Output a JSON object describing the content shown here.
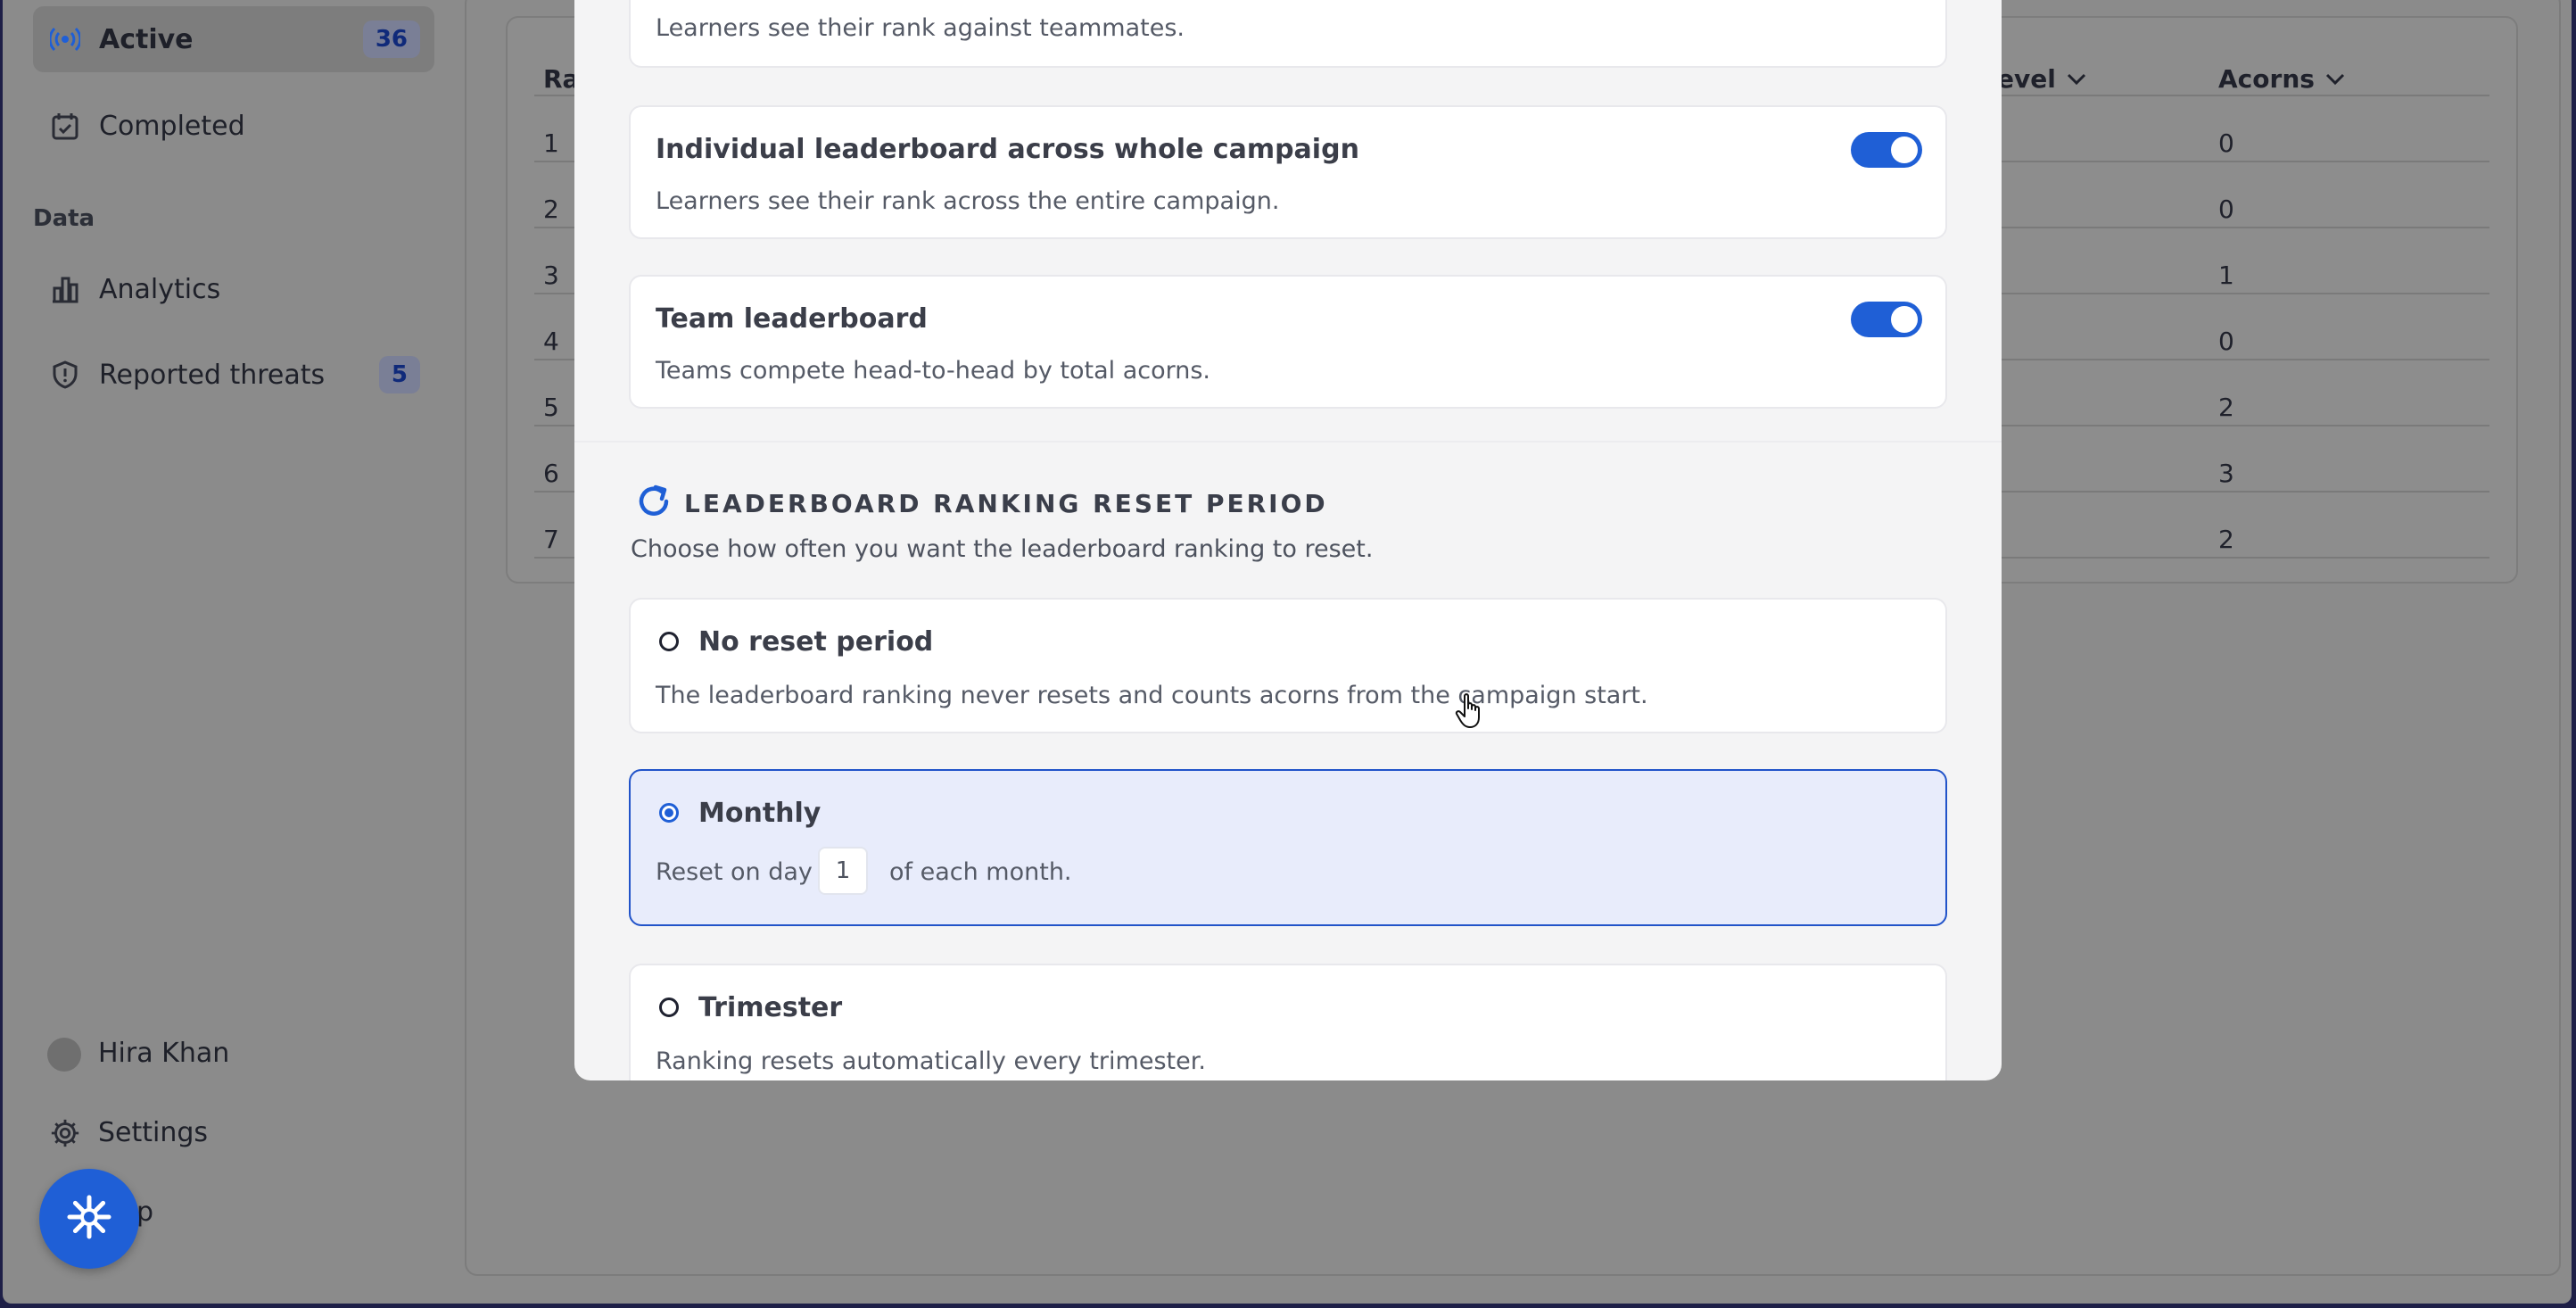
{
  "sidebar": {
    "items": [
      {
        "label": "Active",
        "badge": "36",
        "icon": "broadcast-icon"
      },
      {
        "label": "Completed",
        "icon": "calendar-check-icon"
      },
      {
        "label": "Analytics",
        "icon": "bar-chart-icon"
      },
      {
        "label": "Reported threats",
        "badge": "5",
        "icon": "shield-alert-icon"
      }
    ],
    "section_data": "Data",
    "user_name": "Hira Khan",
    "settings_label": "Settings",
    "help_label_partial": "p"
  },
  "table": {
    "col_rank_partial": "Ra",
    "col_level_partial": "evel",
    "col_acorns": "Acorns",
    "rows": [
      {
        "rank": "1",
        "acorns": "0"
      },
      {
        "rank": "2",
        "acorns": "0"
      },
      {
        "rank": "3",
        "acorns": "1"
      },
      {
        "rank": "4",
        "acorns": "0"
      },
      {
        "rank": "5",
        "acorns": "2"
      },
      {
        "rank": "6",
        "acorns": "3"
      },
      {
        "rank": "7",
        "acorns": "2"
      }
    ]
  },
  "modal": {
    "team_rank_desc": "Learners see their rank against teammates.",
    "individual": {
      "title": "Individual leaderboard across whole campaign",
      "desc": "Learners see their rank across the entire campaign.",
      "enabled": true
    },
    "team": {
      "title": "Team leaderboard",
      "desc": "Teams compete head-to-head by total acorns.",
      "enabled": true
    },
    "reset_section": {
      "heading": "LEADERBOARD RANKING RESET PERIOD",
      "subtitle": "Choose how often you want the leaderboard ranking to reset.",
      "options": [
        {
          "title": "No reset period",
          "desc": "The leaderboard ranking never resets and counts acorns from the campaign start.",
          "selected": false
        },
        {
          "title": "Monthly",
          "desc_before": "Reset on day",
          "day_value": "1",
          "desc_after": "of each month.",
          "selected": true
        },
        {
          "title": "Trimester",
          "desc": "Ranking resets automatically every trimester.",
          "selected": false
        }
      ]
    }
  },
  "colors": {
    "accent": "#1f5fd6",
    "selected_bg": "#e8ecfb",
    "overlay": "#8b8b8b"
  }
}
